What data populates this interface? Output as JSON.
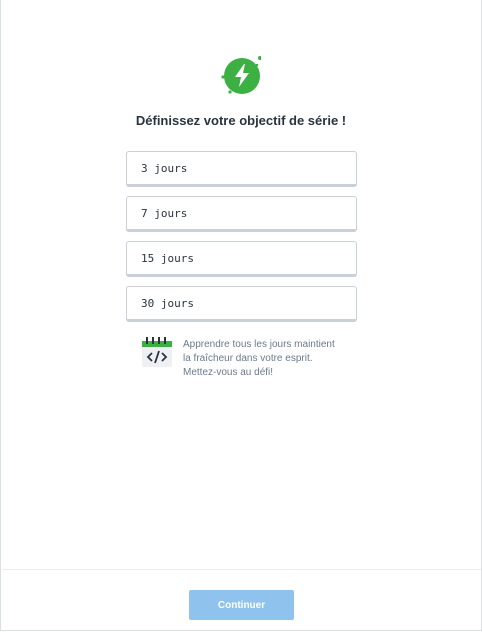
{
  "header": {
    "icon": "lightning-bolt-icon",
    "title": "Définissez votre objectif de série !"
  },
  "options": [
    {
      "label": "3 jours"
    },
    {
      "label": "7 jours"
    },
    {
      "label": "15 jours"
    },
    {
      "label": "30 jours"
    }
  ],
  "tip": {
    "icon": "calendar-code-icon",
    "line1": "Apprendre tous les jours maintient",
    "line2": "la fraîcheur dans votre esprit.",
    "line3": "Mettez-vous au défi!"
  },
  "footer": {
    "continue_label": "Continuer"
  },
  "colors": {
    "accent_green": "#3cb043",
    "button_disabled_blue": "#8fc3ee",
    "title_text": "#2a3340",
    "muted_text": "#6b7a8f"
  }
}
